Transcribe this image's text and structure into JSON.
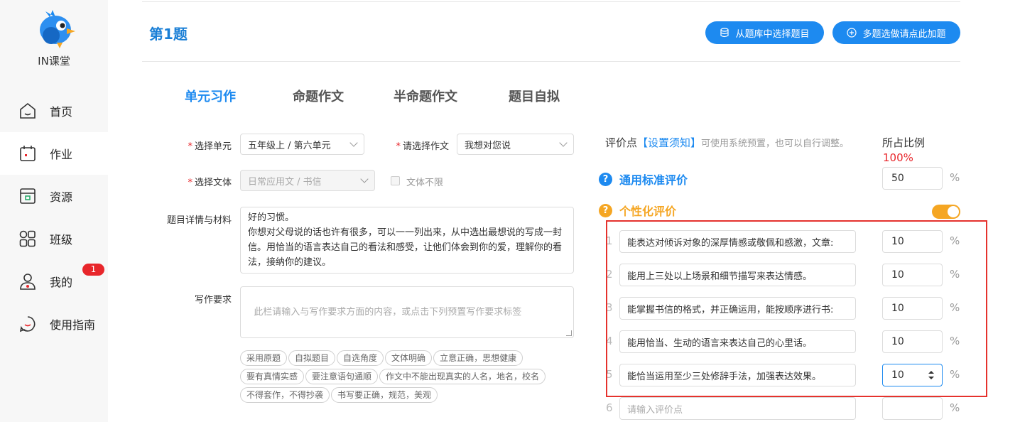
{
  "sidebar": {
    "brand": "IN课堂",
    "items": [
      {
        "label": "首页",
        "icon": "home-icon"
      },
      {
        "label": "作业",
        "icon": "homework-icon"
      },
      {
        "label": "资源",
        "icon": "resource-icon"
      },
      {
        "label": "班级",
        "icon": "class-icon"
      },
      {
        "label": "我的",
        "icon": "user-icon"
      },
      {
        "label": "使用指南",
        "icon": "guide-icon"
      }
    ],
    "badge": "1"
  },
  "header": {
    "title": "第1题",
    "btn_bank": "从题库中选择题目",
    "btn_multi": "多题选做请点此加题"
  },
  "tabs": [
    "单元习作",
    "命题作文",
    "半命题作文",
    "题目自拟"
  ],
  "form": {
    "unit_label": "选择单元",
    "unit_value": "五年级上 / 第六单元",
    "essay_label": "请选择作文",
    "essay_value": "我想对您说",
    "genre_label": "选择文体",
    "genre_value": "日常应用文 / 书信",
    "genre_unlimited": "文体不限",
    "material_label": "题目详情与材料",
    "material_text": "好的习惯。\n你想对父母说的话也许有很多，可以一一列出来，从中选出最想说的写成一封信。用恰当的语言表达自己的看法和感受，让他们体会到你的爱，理解你的看法，接纳你的建议。",
    "req_label": "写作要求",
    "req_placeholder": "此栏请输入与写作要求方面的内容，或点击下列预置写作要求标签",
    "tags": [
      "采用原题",
      "自拟题目",
      "自选角度",
      "文体明确",
      "立意正确，思想健康",
      "要有真情实感",
      "要注意语句通顺",
      "作文中不能出现真实的人名，地名，校名",
      "不得套作，不得抄袭",
      "书写要正确，规范，美观"
    ]
  },
  "eval": {
    "head_main": "评价点",
    "head_link": "【设置须知】",
    "head_hint": "可使用系统预置，也可以自行调整。",
    "ratio_label": "所占比例",
    "ratio_total": "100%",
    "general_title": "通用标准评价",
    "general_value": "50",
    "personal_title": "个性化评价",
    "pct": "%",
    "rows": [
      {
        "num": "1",
        "text": "能表达对倾诉对象的深厚情感或敬佩和感激，文章:",
        "value": "10"
      },
      {
        "num": "2",
        "text": "能用上三处以上场景和细节描写来表达情感。",
        "value": "10"
      },
      {
        "num": "3",
        "text": "能掌握书信的格式，并正确运用，能按顺序进行书:",
        "value": "10"
      },
      {
        "num": "4",
        "text": "能用恰当、生动的语言来表达自己的心里话。",
        "value": "10"
      },
      {
        "num": "5",
        "text": "能恰当运用至少三处修辞手法，加强表达效果。",
        "value": "10"
      },
      {
        "num": "6",
        "placeholder": "请输入评价点",
        "value": ""
      }
    ]
  },
  "colors": {
    "primary": "#1d8af0",
    "accent": "#f5a623",
    "danger": "#e5322d"
  }
}
